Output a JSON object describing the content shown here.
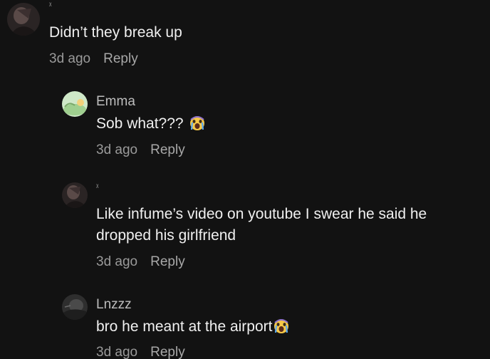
{
  "comments": [
    {
      "username": "ᵡ",
      "text": "Didn’t they break up",
      "time": "3d ago",
      "reply_label": "Reply"
    },
    {
      "username": "Emma",
      "text": "Sob what???",
      "emoji": "screaming-crying-face-emoji",
      "time": "3d ago",
      "reply_label": "Reply"
    },
    {
      "username": "ᵡ",
      "text_line1": "Like infume’s video on youtube I swear he said he",
      "text_line2": "dropped his girlfriend",
      "time": "3d ago",
      "reply_label": "Reply"
    },
    {
      "username": "Lnzzz",
      "text": "bro he meant at the airport",
      "emoji": "screaming-crying-face-emoji",
      "time": "3d ago",
      "reply_label": "Reply"
    }
  ],
  "colors": {
    "background": "#121212",
    "text": "#f0f0f0",
    "meta": "#9a9a9a"
  }
}
